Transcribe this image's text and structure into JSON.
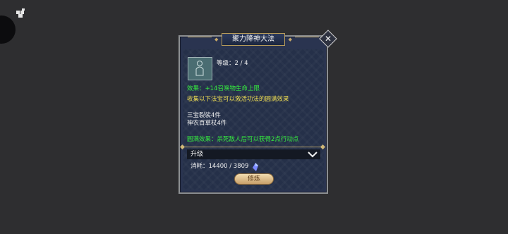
{
  "title": "聚力降神大法",
  "level_label": "等级：2 / 4",
  "effect_line": "效果：+14召唤物生命上限",
  "collect_line": "收集以下法宝可以激活功法的圆满效果",
  "treasures": [
    "三宝裂裟4件",
    "神农百草杖4件"
  ],
  "perfect_effect": "圆满效果：杀死敌人后可以获得2点行动点",
  "upgrade_label": "升级",
  "cost_label": "消耗：14400 / 3809",
  "train_button": "修炼",
  "colors": {
    "effect_green": "#35ec3e",
    "description_yellow": "#f0de52",
    "panel_blue": "#253049",
    "gold_trim": "#b59a5a"
  }
}
